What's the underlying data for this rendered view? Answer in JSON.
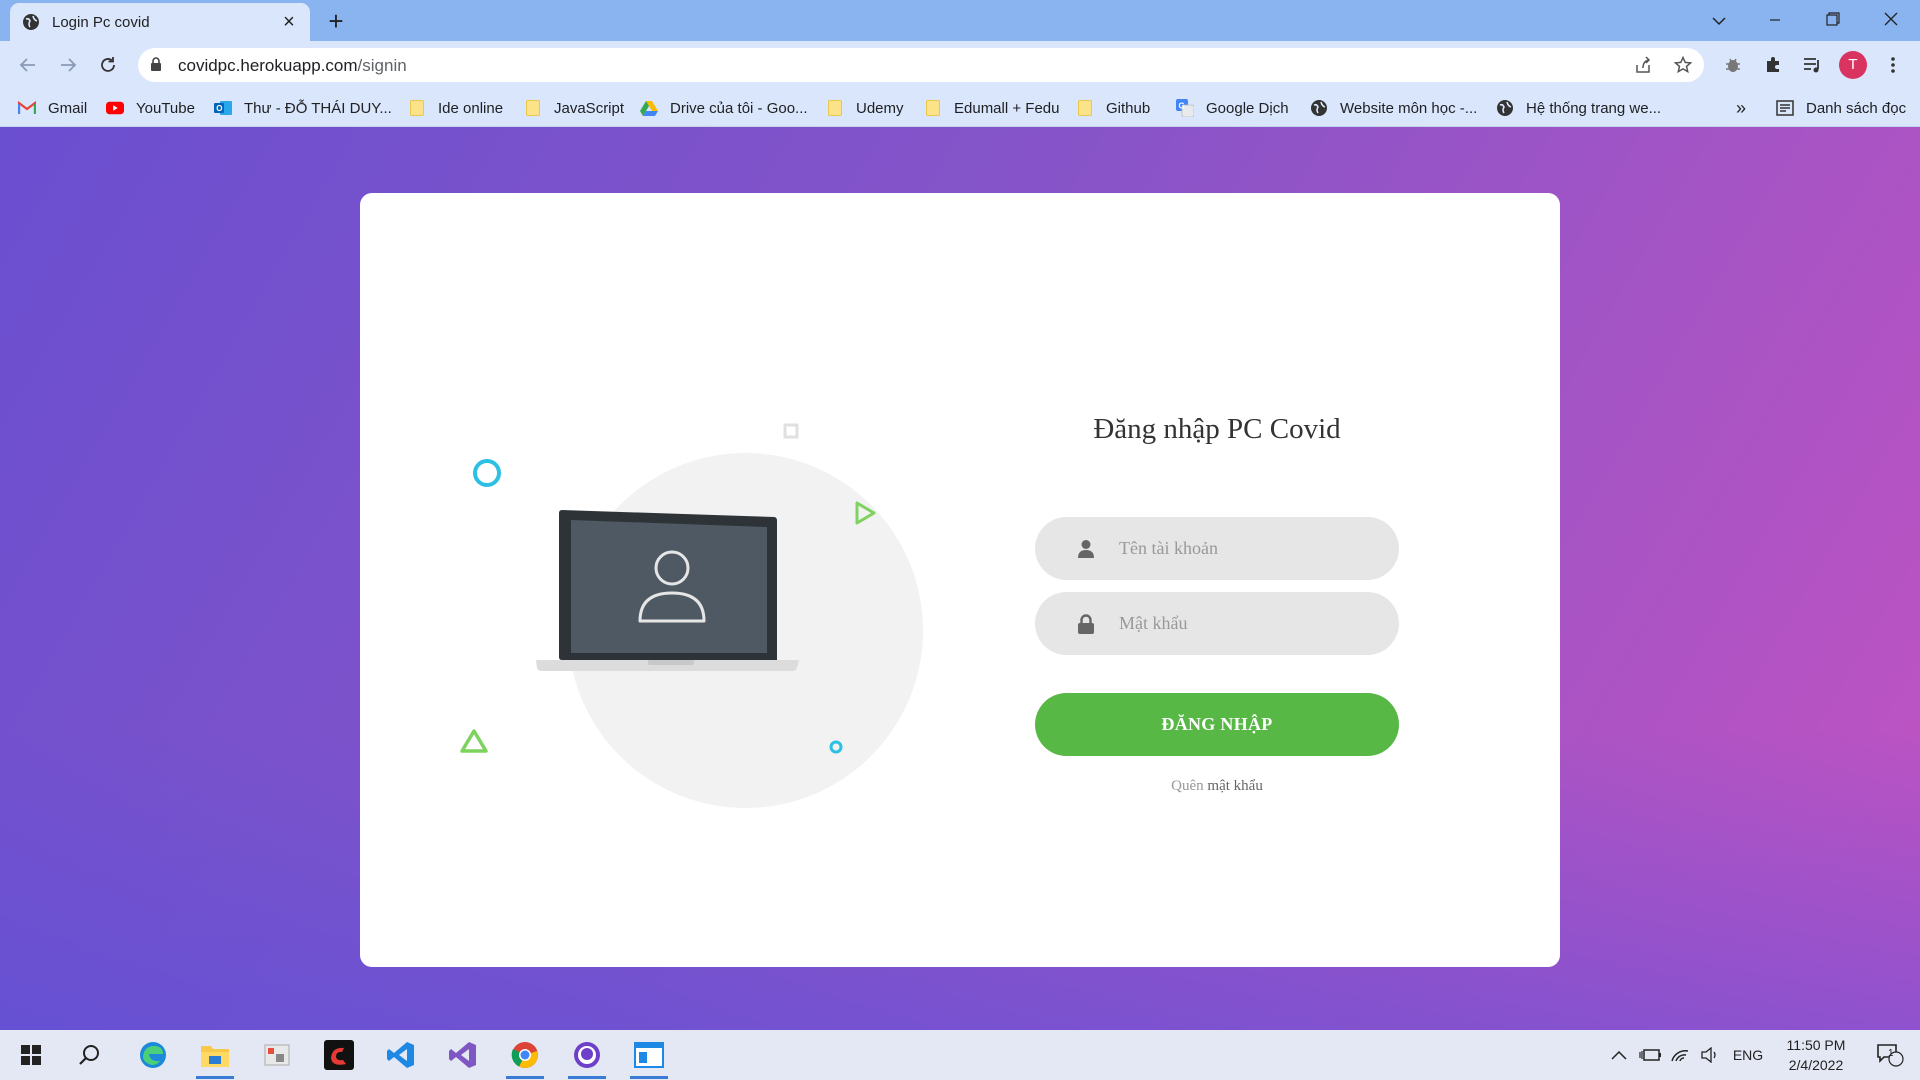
{
  "browser": {
    "tab_title": "Login Pc covid",
    "url_host": "covidpc.herokuapp.com",
    "url_path": "/signin",
    "profile_initial": "T",
    "bookmarks": [
      {
        "label": "Gmail",
        "icon": "gmail-icon"
      },
      {
        "label": "YouTube",
        "icon": "youtube-icon"
      },
      {
        "label": "Thư - ĐỖ THÁI DUY...",
        "icon": "outlook-icon"
      },
      {
        "label": "Ide online",
        "icon": "folder-icon"
      },
      {
        "label": "JavaScript",
        "icon": "folder-icon"
      },
      {
        "label": "Drive của tôi - Goo...",
        "icon": "drive-icon"
      },
      {
        "label": "Udemy",
        "icon": "folder-icon"
      },
      {
        "label": "Edumall + Fedu",
        "icon": "folder-icon"
      },
      {
        "label": "Github",
        "icon": "folder-icon"
      },
      {
        "label": "Google Dịch",
        "icon": "translate-icon"
      },
      {
        "label": "Website môn học -...",
        "icon": "globe-icon"
      },
      {
        "label": "Hệ thống trang we...",
        "icon": "globe-icon"
      }
    ],
    "more_bookmarks": "»",
    "reading_list": "Danh sách đọc"
  },
  "login": {
    "title": "Đăng nhập PC Covid",
    "username_placeholder": "Tên tài khoản",
    "password_placeholder": "Mật khẩu",
    "submit_label": "ĐĂNG NHẬP",
    "forgot_prefix": "Quên",
    "forgot_link": "mật khẩu"
  },
  "taskbar": {
    "language": "ENG",
    "time": "11:50 PM",
    "date": "2/4/2022",
    "notification_count": "1"
  },
  "colors": {
    "accent_green": "#57b846",
    "gradient_start": "#6a4fd0",
    "gradient_end": "#c353c2"
  }
}
